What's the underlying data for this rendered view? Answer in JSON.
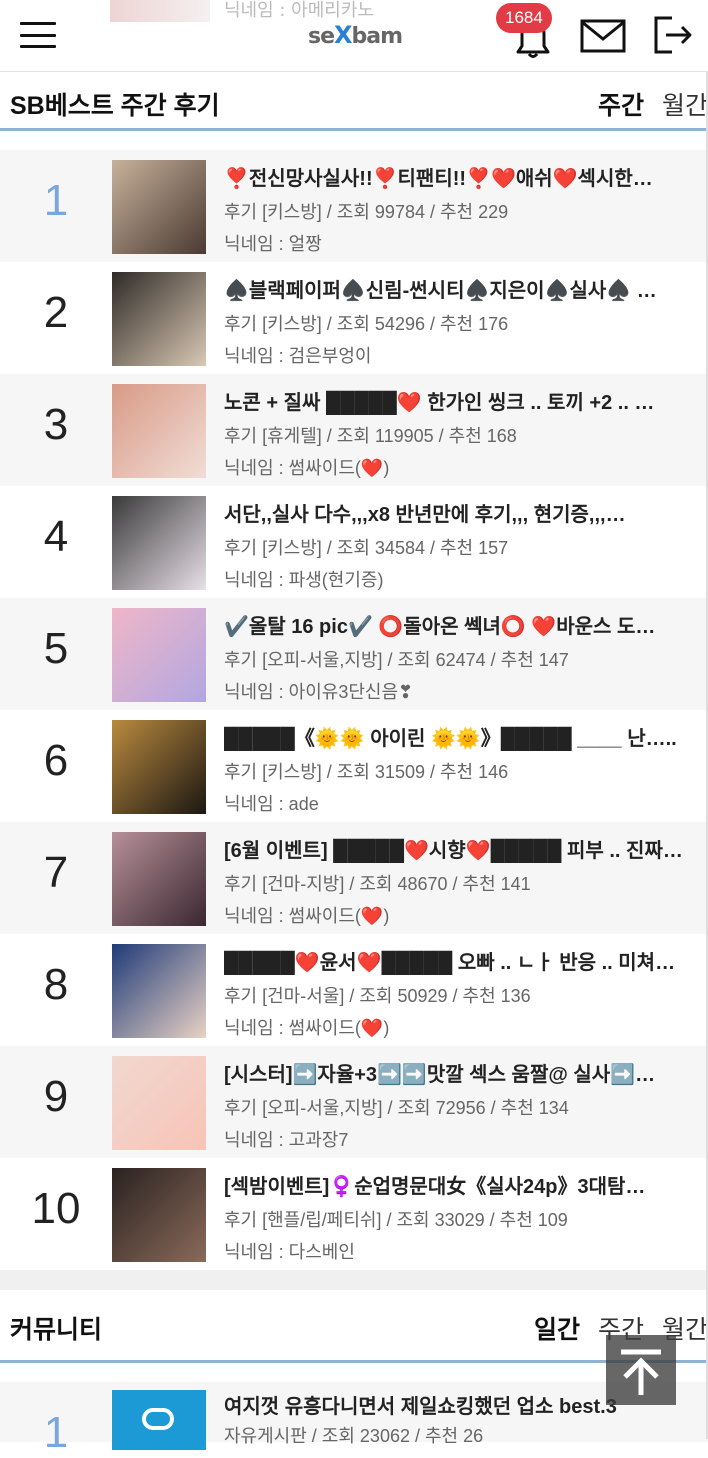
{
  "header": {
    "peek_text": "닉네임 : 아메리카노",
    "logo_left": "se",
    "logo_x": "X",
    "logo_right": "bam",
    "notification_count": "1684",
    "icons": [
      "menu-icon",
      "bell-icon",
      "mail-icon",
      "logout-icon"
    ]
  },
  "best": {
    "title": "SB베스트 주간 후기",
    "tabs": [
      {
        "label": "주간",
        "active": true
      },
      {
        "label": "월간",
        "active": false
      }
    ],
    "items": [
      {
        "rank": "1",
        "title": "❣️전신망사실사!!❣️티팬티!!❣️❤️애쉬❤️섹시한…",
        "meta": "후기 [키스방] / 조회 99784 / 추천 229",
        "nick": "닉네임 : 얼짱",
        "thumb": [
          "#c7b19a",
          "#4b3a33"
        ]
      },
      {
        "rank": "2",
        "title": "♠️블랙페이퍼♠️신림-썬시티♠️지은이♠️실사♠️ …",
        "meta": "후기 [키스방] / 조회 54296 / 추천 176",
        "nick": "닉네임 : 검은부엉이",
        "thumb": [
          "#2f2a27",
          "#d9c8b4"
        ]
      },
      {
        "rank": "3",
        "title": "노콘 + 질싸 █████❤️ 한가인 씽크 .. 토끼 +2 .. …",
        "meta": "후기 [휴게텔] / 조회 119905 / 추천 168",
        "nick": "닉네임 : 썸싸이드(❤️)",
        "thumb": [
          "#d89a86",
          "#f1ddd6"
        ]
      },
      {
        "rank": "4",
        "title": "서단,,실사 다수,,,x8 반년만에 후기,,, 현기증,,,…",
        "meta": "후기 [키스방] / 조회 34584 / 추천 157",
        "nick": "닉네임 : 파생(현기증)",
        "thumb": [
          "#3a3a3a",
          "#e8e0e8"
        ]
      },
      {
        "rank": "5",
        "title": "✔️올탈 16 pic✔️ ⭕돌아온 쎅녀⭕ ❤️바운스 도…",
        "meta": "후기 [오피-서울,지방] / 조회 62474 / 추천 147",
        "nick": "닉네임 : 아이유3단신음❣",
        "thumb": [
          "#efb6c8",
          "#b2a7e0"
        ]
      },
      {
        "rank": "6",
        "title": "█████《🌞🌞 아이린 🌞🌞》█████ ____ 난…..",
        "meta": "후기 [키스방] / 조회 31509 / 추천 146",
        "nick": "닉네임 : ade",
        "thumb": [
          "#b98a3e",
          "#1c1713"
        ]
      },
      {
        "rank": "7",
        "title": "[6월 이벤트] █████❤️시향❤️█████ 피부 .. 진짜 …",
        "meta": "후기 [건마-지방] / 조회 48670 / 추천 141",
        "nick": "닉네임 : 썸싸이드(❤️)",
        "thumb": [
          "#b7909a",
          "#3a2730"
        ]
      },
      {
        "rank": "8",
        "title": "█████❤️윤서❤️█████ 오빠 .. ㄴㅏ 반응 .. 미쳐…",
        "meta": "후기 [건마-서울] / 조회 50929 / 추천 136",
        "nick": "닉네임 : 썸싸이드(❤️)",
        "thumb": [
          "#1f3a78",
          "#e8d2c4"
        ]
      },
      {
        "rank": "9",
        "title": "[시스터]➡️자율+3➡️➡️맛깔 섹스 움짤@ 실사➡️…",
        "meta": "후기 [오피-서울,지방] / 조회 72956 / 추천 134",
        "nick": "닉네임 : 고과장7",
        "thumb": [
          "#f1d8d0",
          "#f7c4b7"
        ]
      },
      {
        "rank": "10",
        "title": "[섹밤이벤트]♀️순업명문대女《실사24p》3대탐…",
        "meta": "후기 [핸플/립/페티쉬] / 조회 33029 / 추천 109",
        "nick": "닉네임 : 다스베인",
        "thumb": [
          "#2a2220",
          "#8a6a5a"
        ]
      }
    ]
  },
  "community": {
    "title": "커뮤니티",
    "tabs": [
      {
        "label": "일간",
        "active": true
      },
      {
        "label": "주간",
        "active": false
      },
      {
        "label": "월간",
        "active": false
      }
    ],
    "first": {
      "rank": "1",
      "title": "여지껏 유흥다니면서 제일쇼킹했던 업소 best.3",
      "meta": "자유게시판 / 조회 23062 / 추천 26"
    }
  },
  "scroll_top_icon": "arrow-up-to-top-icon"
}
